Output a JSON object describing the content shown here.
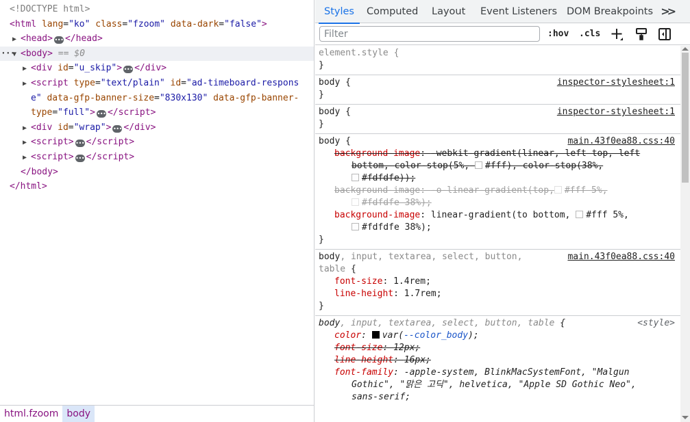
{
  "elements": {
    "doctype": "<!DOCTYPE html>",
    "html_open": {
      "tag": "html",
      "attrs": [
        {
          "name": "lang",
          "value": "\"ko\""
        },
        {
          "name": "class",
          "value": "\"fzoom\""
        },
        {
          "name": "data-dark",
          "value": "\"false\""
        }
      ]
    },
    "head": "head",
    "body_marker": "== $0",
    "div_u_skip": {
      "tag": "div",
      "attr": "id",
      "value": "\"u_skip\""
    },
    "script_timeboard": {
      "tag": "script",
      "type_attr": "type",
      "type_value": "\"text/plain\"",
      "id_attr": "id",
      "id_value_1": "\"ad-timeboard-respons",
      "id_value_2": "e\"",
      "size_attr": "data-gfp-banner-size",
      "size_value": "\"830x130\"",
      "banner_attr_1": "data-gfp-banner-",
      "banner_attr_2": "type",
      "banner_value": "\"full\""
    },
    "div_wrap": {
      "tag": "div",
      "attr": "id",
      "value": "\"wrap\""
    },
    "script": "script"
  },
  "breadcrumbs": [
    "html.fzoom",
    "body"
  ],
  "styles": {
    "tabs": [
      "Styles",
      "Computed",
      "Layout",
      "Event Listeners",
      "DOM Breakpoints"
    ],
    "more_tabs": ">>",
    "filter_placeholder": "Filter",
    "hov": ":hov",
    "cls": ".cls",
    "rules": {
      "element_style": "element.style",
      "inspector_src": "inspector-stylesheet:1",
      "main_src": "main.43f0ea88.css:40",
      "style_src": "<style>",
      "body": "body",
      "body_list_rest": ", input, textarea, select, button,",
      "body_list_table": "table",
      "body_list_italic_rest": ", input, textarea, select, button, table",
      "bg_image": "background-image",
      "bg_webkit_1": "-webkit-gradient(linear, left top, left",
      "bg_webkit_2": "bottom, color-stop(5%,",
      "bg_webkit_2b": "#fff), color-stop(38%,",
      "bg_webkit_3": "#fdfdfe));",
      "bg_o_1": "-o-linear-gradient(top,",
      "bg_o_1b": "#fff 5%,",
      "bg_o_2": "#fdfdfe 38%);",
      "bg_lin_1": "linear-gradient(to bottom,",
      "bg_lin_1b": "#fff 5%,",
      "bg_lin_2": "#fdfdfe 38%);",
      "font_size": "font-size",
      "font_size_val": "1.4rem;",
      "line_height": "line-height",
      "line_height_val": "1.7rem;",
      "color": "color",
      "color_var_open": "var(",
      "color_var": "--color_body",
      "color_var_close": ");",
      "font_size_12": "12px;",
      "line_height_16": "16px;",
      "font_family": "font-family",
      "font_family_1": "-apple-system, BlinkMacSystemFont, \"Malgun",
      "font_family_2": "Gothic\", \"맑은 고딕\", helvetica, \"Apple SD Gothic Neo\",",
      "font_family_3": "sans-serif;"
    }
  },
  "colors": {
    "tag": "#881280",
    "attr_name": "#994500",
    "attr_value": "#1a1aa6",
    "active_tab": "#1a73e8",
    "prop_name": "#c80000",
    "swatch_white": "#fff",
    "swatch_offwhite": "#fdfdfe",
    "swatch_black": "#000000"
  }
}
